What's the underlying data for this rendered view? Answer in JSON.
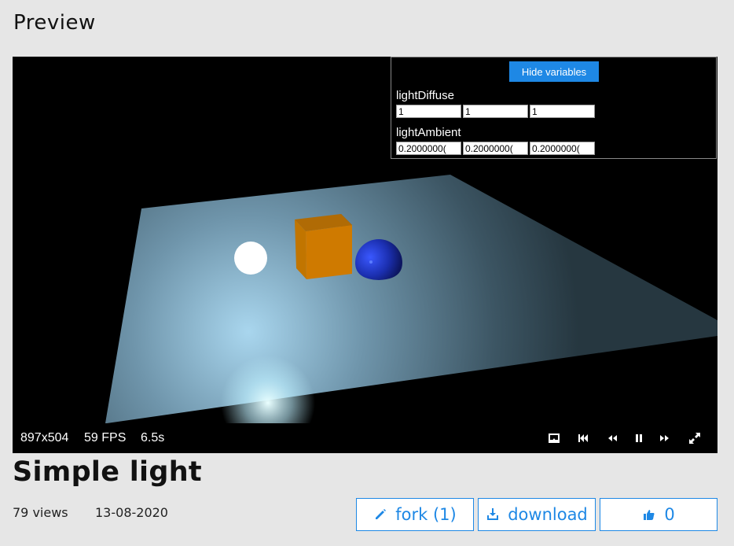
{
  "page": {
    "heading": "Preview"
  },
  "variables_panel": {
    "hide_button_label": "Hide variables",
    "variables": [
      {
        "name": "lightDiffuse",
        "values": [
          "1",
          "1",
          "1"
        ]
      },
      {
        "name": "lightAmbient",
        "values": [
          "0.2000000(",
          "0.2000000(",
          "0.2000000("
        ]
      }
    ]
  },
  "statusbar": {
    "resolution": "897x504",
    "fps": "59 FPS",
    "time": "6.5s"
  },
  "shader": {
    "title": "Simple light",
    "views": "79 views",
    "date": "13-08-2020"
  },
  "actions": {
    "fork_label": "fork (1)",
    "download_label": "download",
    "likes": "0"
  },
  "colors": {
    "accent": "#1e88e5",
    "background": "#e6e6e6"
  }
}
